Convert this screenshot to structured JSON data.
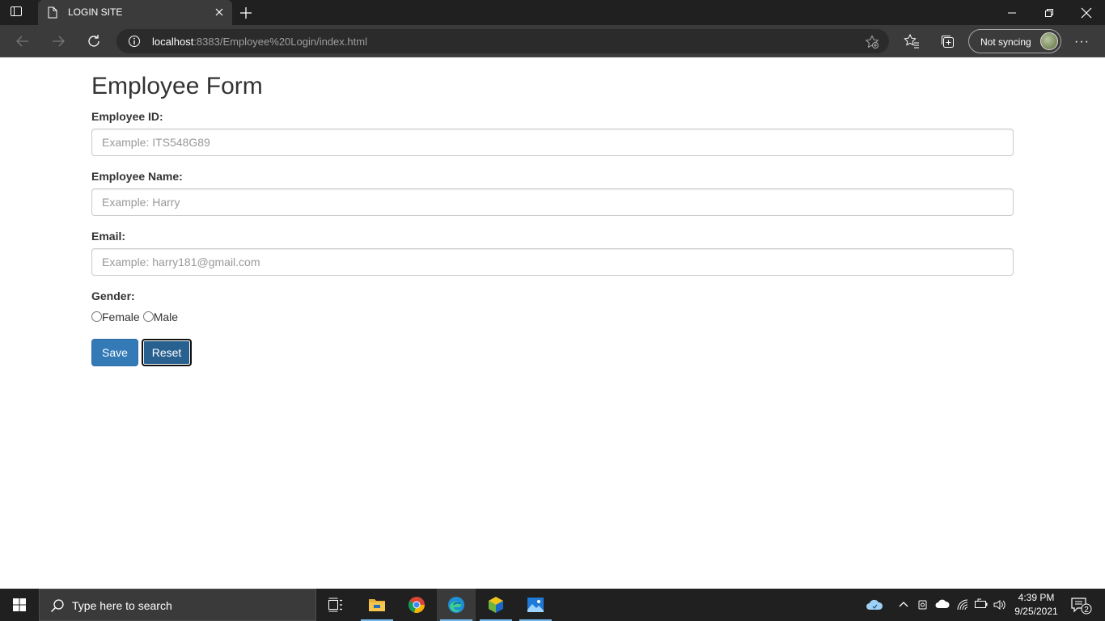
{
  "browser": {
    "tab_title": "LOGIN SITE",
    "url_host": "localhost",
    "url_rest": ":8383/Employee%20Login/index.html",
    "sync_label": "Not syncing",
    "more_label": "···"
  },
  "form": {
    "heading": "Employee Form",
    "employee_id": {
      "label": "Employee ID:",
      "placeholder": "Example: ITS548G89"
    },
    "employee_name": {
      "label": "Employee Name:",
      "placeholder": "Example: Harry"
    },
    "email": {
      "label": "Email:",
      "placeholder": "Example: harry181@gmail.com"
    },
    "gender": {
      "label": "Gender:",
      "options": [
        "Female",
        "Male"
      ]
    },
    "save_label": "Save",
    "reset_label": "Reset"
  },
  "taskbar": {
    "search_placeholder": "Type here to search",
    "time": "4:39 PM",
    "date": "9/25/2021",
    "notification_count": "2"
  },
  "colors": {
    "primary": "#337ab7",
    "primary_active": "#286090",
    "chrome_dark": "#202020",
    "chrome_toolbar": "#3b3b3b"
  }
}
